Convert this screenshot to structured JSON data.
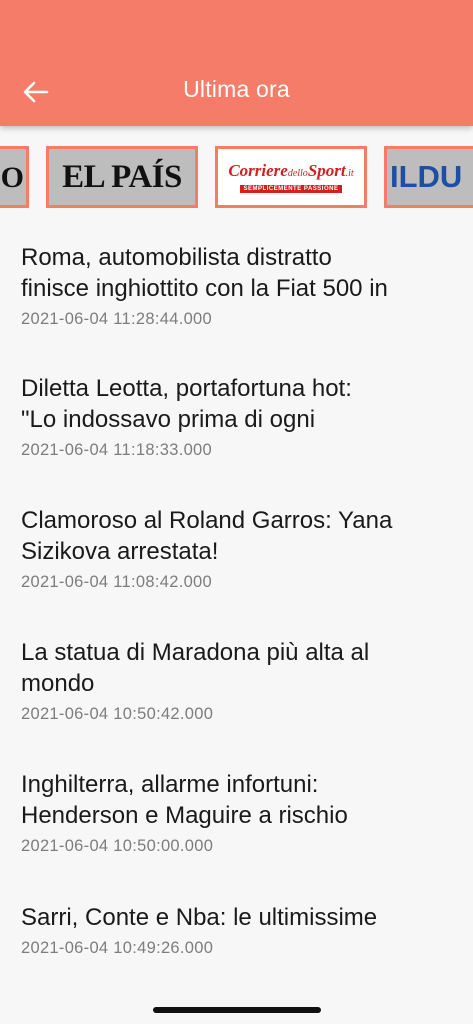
{
  "header": {
    "title": "Ultima ora",
    "back_icon": "arrow-left-icon",
    "background_color": "#f47c69"
  },
  "logos": {
    "prev_partial": "O",
    "elpais": "EL PAÍS",
    "corriere_main": "Corriere",
    "corriere_dello": "dello",
    "corriere_sport": "Sport",
    "corriere_tld": ".it",
    "corriere_tagline": "SEMPLICEMENTE PASSIONE",
    "next_partial": "ILDU"
  },
  "news": [
    {
      "title": "Roma, automobilista distratto finisce inghiottito con la Fiat 500 in",
      "date": "2021-06-04 11:28:44.000"
    },
    {
      "title": "Diletta Leotta, portafortuna hot: \"Lo indossavo prima di ogni",
      "date": "2021-06-04 11:18:33.000"
    },
    {
      "title": "Clamoroso al Roland Garros: Yana Sizikova arrestata!",
      "date": "2021-06-04 11:08:42.000"
    },
    {
      "title": "La statua di Maradona più alta al mondo",
      "date": "2021-06-04 10:50:42.000"
    },
    {
      "title": "Inghilterra, allarme infortuni: Henderson e Maguire a rischio",
      "date": "2021-06-04 10:50:00.000"
    },
    {
      "title": "Sarri, Conte e Nba: le ultimissime",
      "date": "2021-06-04 10:49:26.000"
    }
  ],
  "news_lines": [
    [
      "Roma, automobilista distratto",
      "finisce inghiottito con la Fiat 500 in"
    ],
    [
      "Diletta Leotta, portafortuna hot:",
      "\"Lo indossavo prima di ogni"
    ],
    [
      "Clamoroso al Roland Garros: Yana",
      "Sizikova arrestata!"
    ],
    [
      "La statua di Maradona più alta al",
      "mondo"
    ],
    [
      "Inghilterra, allarme infortuni:",
      "Henderson e Maguire a rischio"
    ],
    [
      "Sarri, Conte e Nba: le ultimissime"
    ]
  ]
}
